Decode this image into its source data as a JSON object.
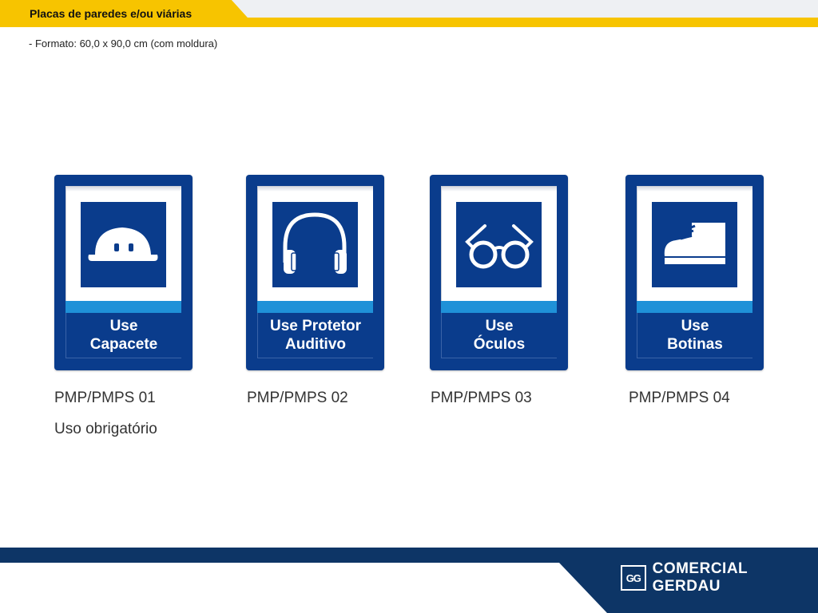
{
  "header": {
    "title": "Placas de paredes e/ou viárias",
    "subtitle": "- Formato: 60,0 x 90,0 cm  (com moldura)"
  },
  "colors": {
    "sign_blue": "#0a3c8c",
    "stripe_cyan": "#1f91d8",
    "header_yellow": "#f7c400",
    "footer_navy": "#0d3566"
  },
  "signs": [
    {
      "line1": "Use",
      "line2": "Capacete",
      "code": "PMP/PMPS 01",
      "icon": "hard-hat-icon"
    },
    {
      "line1": "Use Protetor",
      "line2": "Auditivo",
      "code": "PMP/PMPS 02",
      "icon": "ear-muffs-icon"
    },
    {
      "line1": "Use",
      "line2": "Óculos",
      "code": "PMP/PMPS 03",
      "icon": "safety-glasses-icon"
    },
    {
      "line1": "Use",
      "line2": "Botinas",
      "code": "PMP/PMPS 04",
      "icon": "safety-boot-icon"
    }
  ],
  "usage_text": "Uso obrigatório",
  "footer": {
    "logo_mark": "GG",
    "logo_text": "COMERCIAL GERDAU"
  }
}
